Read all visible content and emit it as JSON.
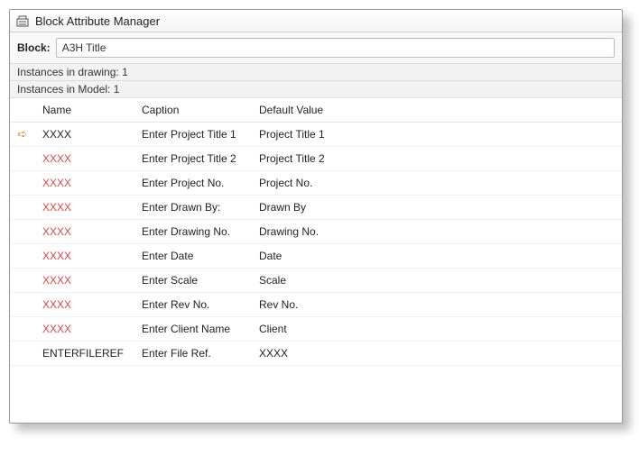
{
  "window_title": "Block Attribute Manager",
  "block_label": "Block:",
  "block_value": "A3H Title",
  "info_drawing": "Instances in drawing:  1",
  "info_model": "Instances in Model:  1",
  "table": {
    "headers": {
      "name": "Name",
      "caption": "Caption",
      "default": "Default Value"
    },
    "rows": [
      {
        "indicator": true,
        "name": "XXXX",
        "warn": false,
        "caption": "Enter Project Title 1",
        "default": "Project Title 1"
      },
      {
        "indicator": false,
        "name": "XXXX",
        "warn": true,
        "caption": "Enter Project Title 2",
        "default": "Project Title 2"
      },
      {
        "indicator": false,
        "name": "XXXX",
        "warn": true,
        "caption": "Enter Project No.",
        "default": "Project No."
      },
      {
        "indicator": false,
        "name": "XXXX",
        "warn": true,
        "caption": "Enter Drawn By:",
        "default": "Drawn By"
      },
      {
        "indicator": false,
        "name": "XXXX",
        "warn": true,
        "caption": "Enter Drawing No.",
        "default": "Drawing No."
      },
      {
        "indicator": false,
        "name": "XXXX",
        "warn": true,
        "caption": "Enter Date",
        "default": "Date"
      },
      {
        "indicator": false,
        "name": "XXXX",
        "warn": true,
        "caption": "Enter Scale",
        "default": "Scale"
      },
      {
        "indicator": false,
        "name": "XXXX",
        "warn": true,
        "caption": "Enter Rev No.",
        "default": "Rev No."
      },
      {
        "indicator": false,
        "name": "XXXX",
        "warn": true,
        "caption": "Enter Client Name",
        "default": "Client"
      },
      {
        "indicator": false,
        "name": "ENTERFILEREF",
        "warn": false,
        "caption": "Enter File Ref.",
        "default": "XXXX"
      }
    ]
  }
}
